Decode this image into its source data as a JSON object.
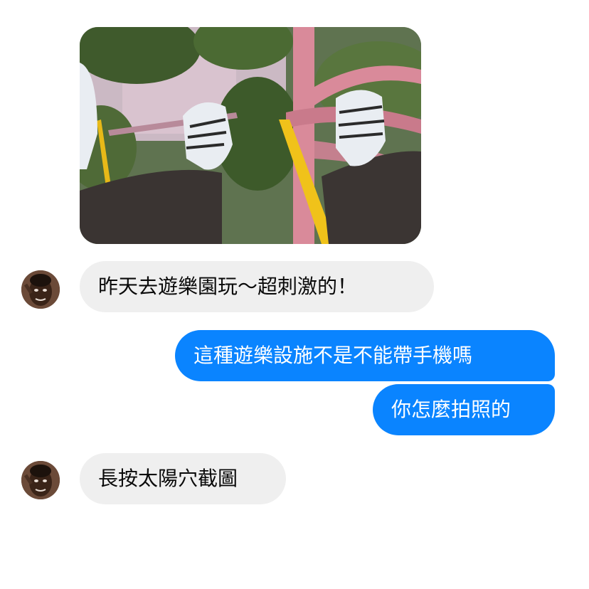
{
  "conversation": {
    "photo": {
      "icon": "roller-coaster-photo"
    },
    "messages": [
      {
        "sender": "friend",
        "avatar_icon": "avatar-icon",
        "text": "昨天去遊樂園玩～超刺激的！"
      },
      {
        "sender": "me",
        "text": "這種遊樂設施不是不能帶手機嗎"
      },
      {
        "sender": "me",
        "text": "你怎麼拍照的"
      },
      {
        "sender": "friend",
        "avatar_icon": "avatar-icon",
        "text": "長按太陽穴截圖"
      }
    ]
  },
  "colors": {
    "incoming_bubble": "#efefef",
    "outgoing_bubble": "#0a84ff",
    "incoming_text": "#0a0a0a",
    "outgoing_text": "#ffffff"
  }
}
